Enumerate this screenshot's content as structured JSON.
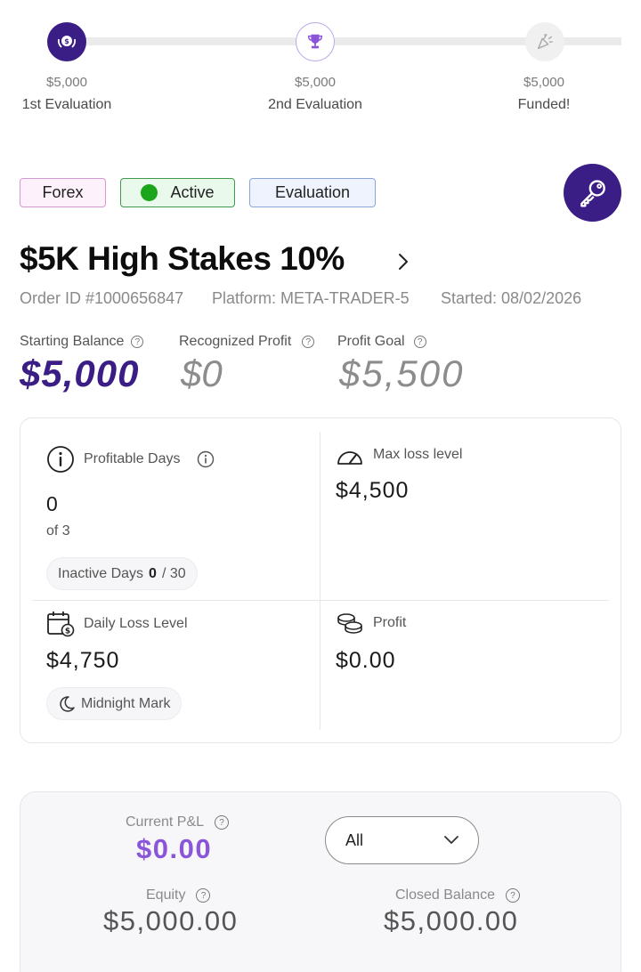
{
  "stepper": [
    {
      "amount": "$5,000",
      "label": "1st Evaluation",
      "icon": "badge-icon"
    },
    {
      "amount": "$5,000",
      "label": "2nd Evaluation",
      "icon": "trophy-icon"
    },
    {
      "amount": "$5,000",
      "label": "Funded!",
      "icon": "party-popper-icon"
    }
  ],
  "chips": {
    "market": "Forex",
    "status": "Active",
    "phase": "Evaluation"
  },
  "account": {
    "title": "$5K High Stakes 10%",
    "order_id": "Order ID #1000656847",
    "platform": "Platform: META-TRADER-5",
    "started": "Started: 08/02/2026"
  },
  "stats": {
    "starting_balance_label": "Starting Balance",
    "starting_balance_value": "$5,000",
    "recognized_profit_label": "Recognized Profit",
    "recognized_profit_value": "$0",
    "profit_goal_label": "Profit Goal",
    "profit_goal_value": "$5,500"
  },
  "card": {
    "profitable_days_label": "Profitable Days",
    "profitable_days_value": "0",
    "profitable_days_of": "of 3",
    "inactive_days_label": "Inactive Days",
    "inactive_days_value": "0",
    "inactive_days_total": "/ 30",
    "max_loss_label": "Max loss level",
    "max_loss_value": "$4,500",
    "daily_loss_label": "Daily Loss Level",
    "daily_loss_value": "$4,750",
    "midnight_label": "Midnight Mark",
    "profit_label": "Profit",
    "profit_value": "$0.00"
  },
  "pnl": {
    "current_label": "Current P&L",
    "current_value": "$0.00",
    "filter_selected": "All",
    "equity_label": "Equity",
    "equity_value": "$5,000.00",
    "closed_label": "Closed Balance",
    "closed_value": "$5,000.00"
  },
  "colors": {
    "brand": "#3a1d85",
    "accent": "#8a55d9",
    "active_green": "#1aa51a"
  }
}
